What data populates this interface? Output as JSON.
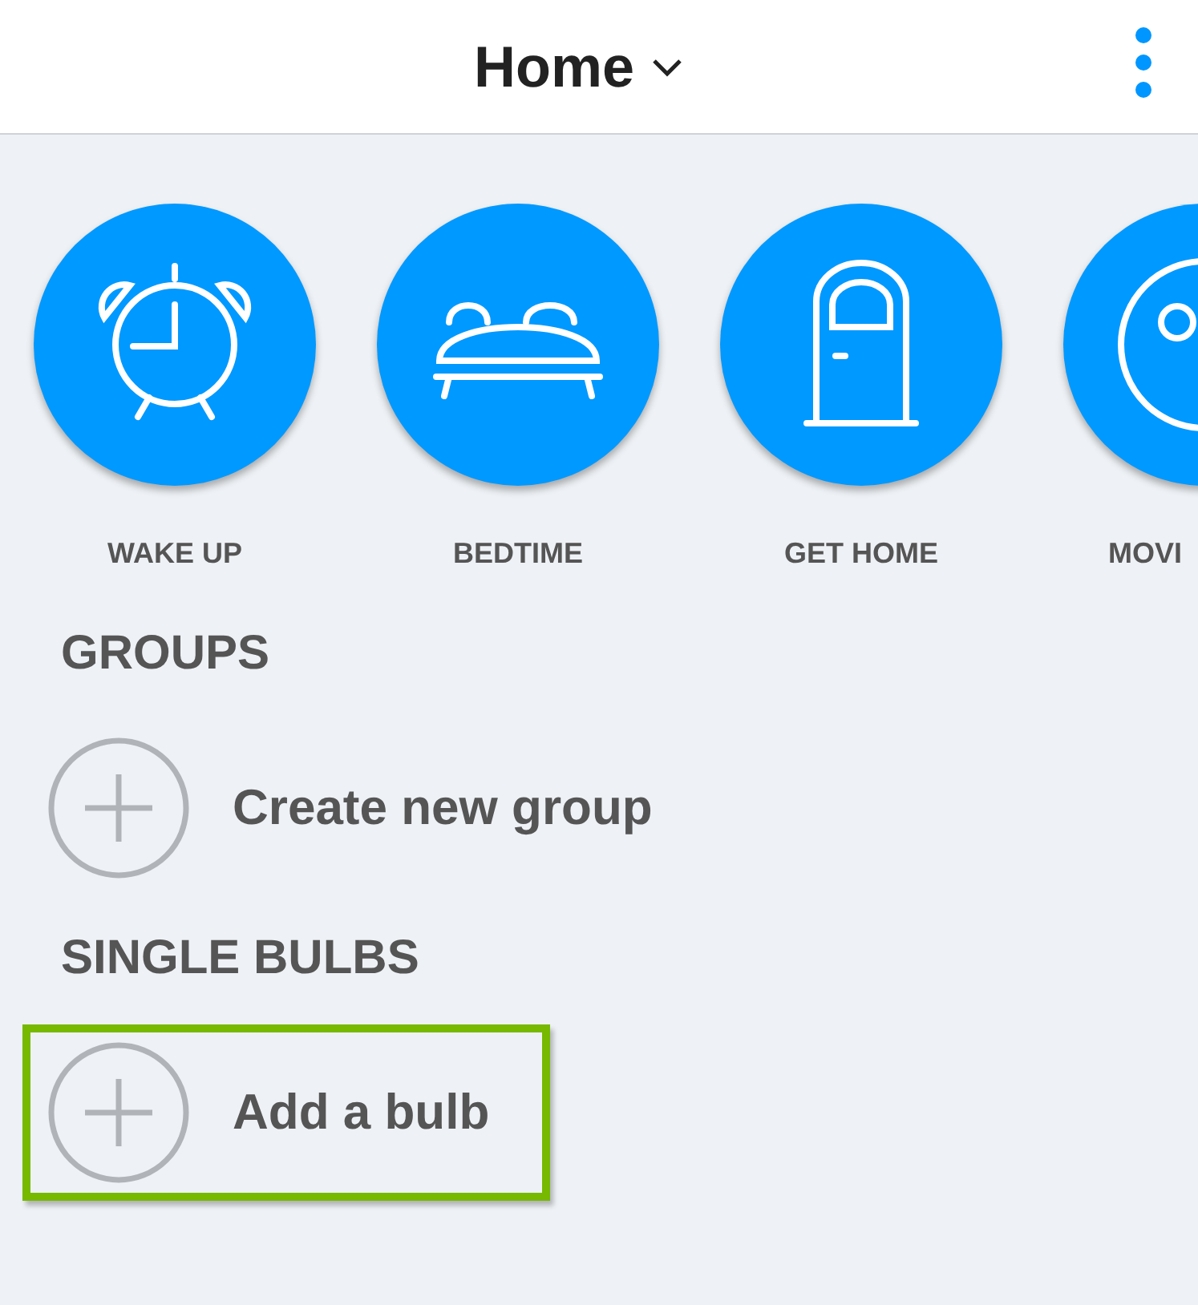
{
  "header": {
    "title": "Home"
  },
  "scenes": [
    {
      "label": "WAKE UP",
      "kind": "alarm"
    },
    {
      "label": "BEDTIME",
      "kind": "bed"
    },
    {
      "label": "GET HOME",
      "kind": "door"
    },
    {
      "label": "MOVI",
      "kind": "film"
    }
  ],
  "sections": [
    {
      "title": "GROUPS",
      "items": [
        {
          "label": "Create new group",
          "highlighted": false
        }
      ]
    },
    {
      "title": "SINGLE BULBS",
      "items": [
        {
          "label": "Add a bulb",
          "highlighted": true
        }
      ]
    }
  ]
}
